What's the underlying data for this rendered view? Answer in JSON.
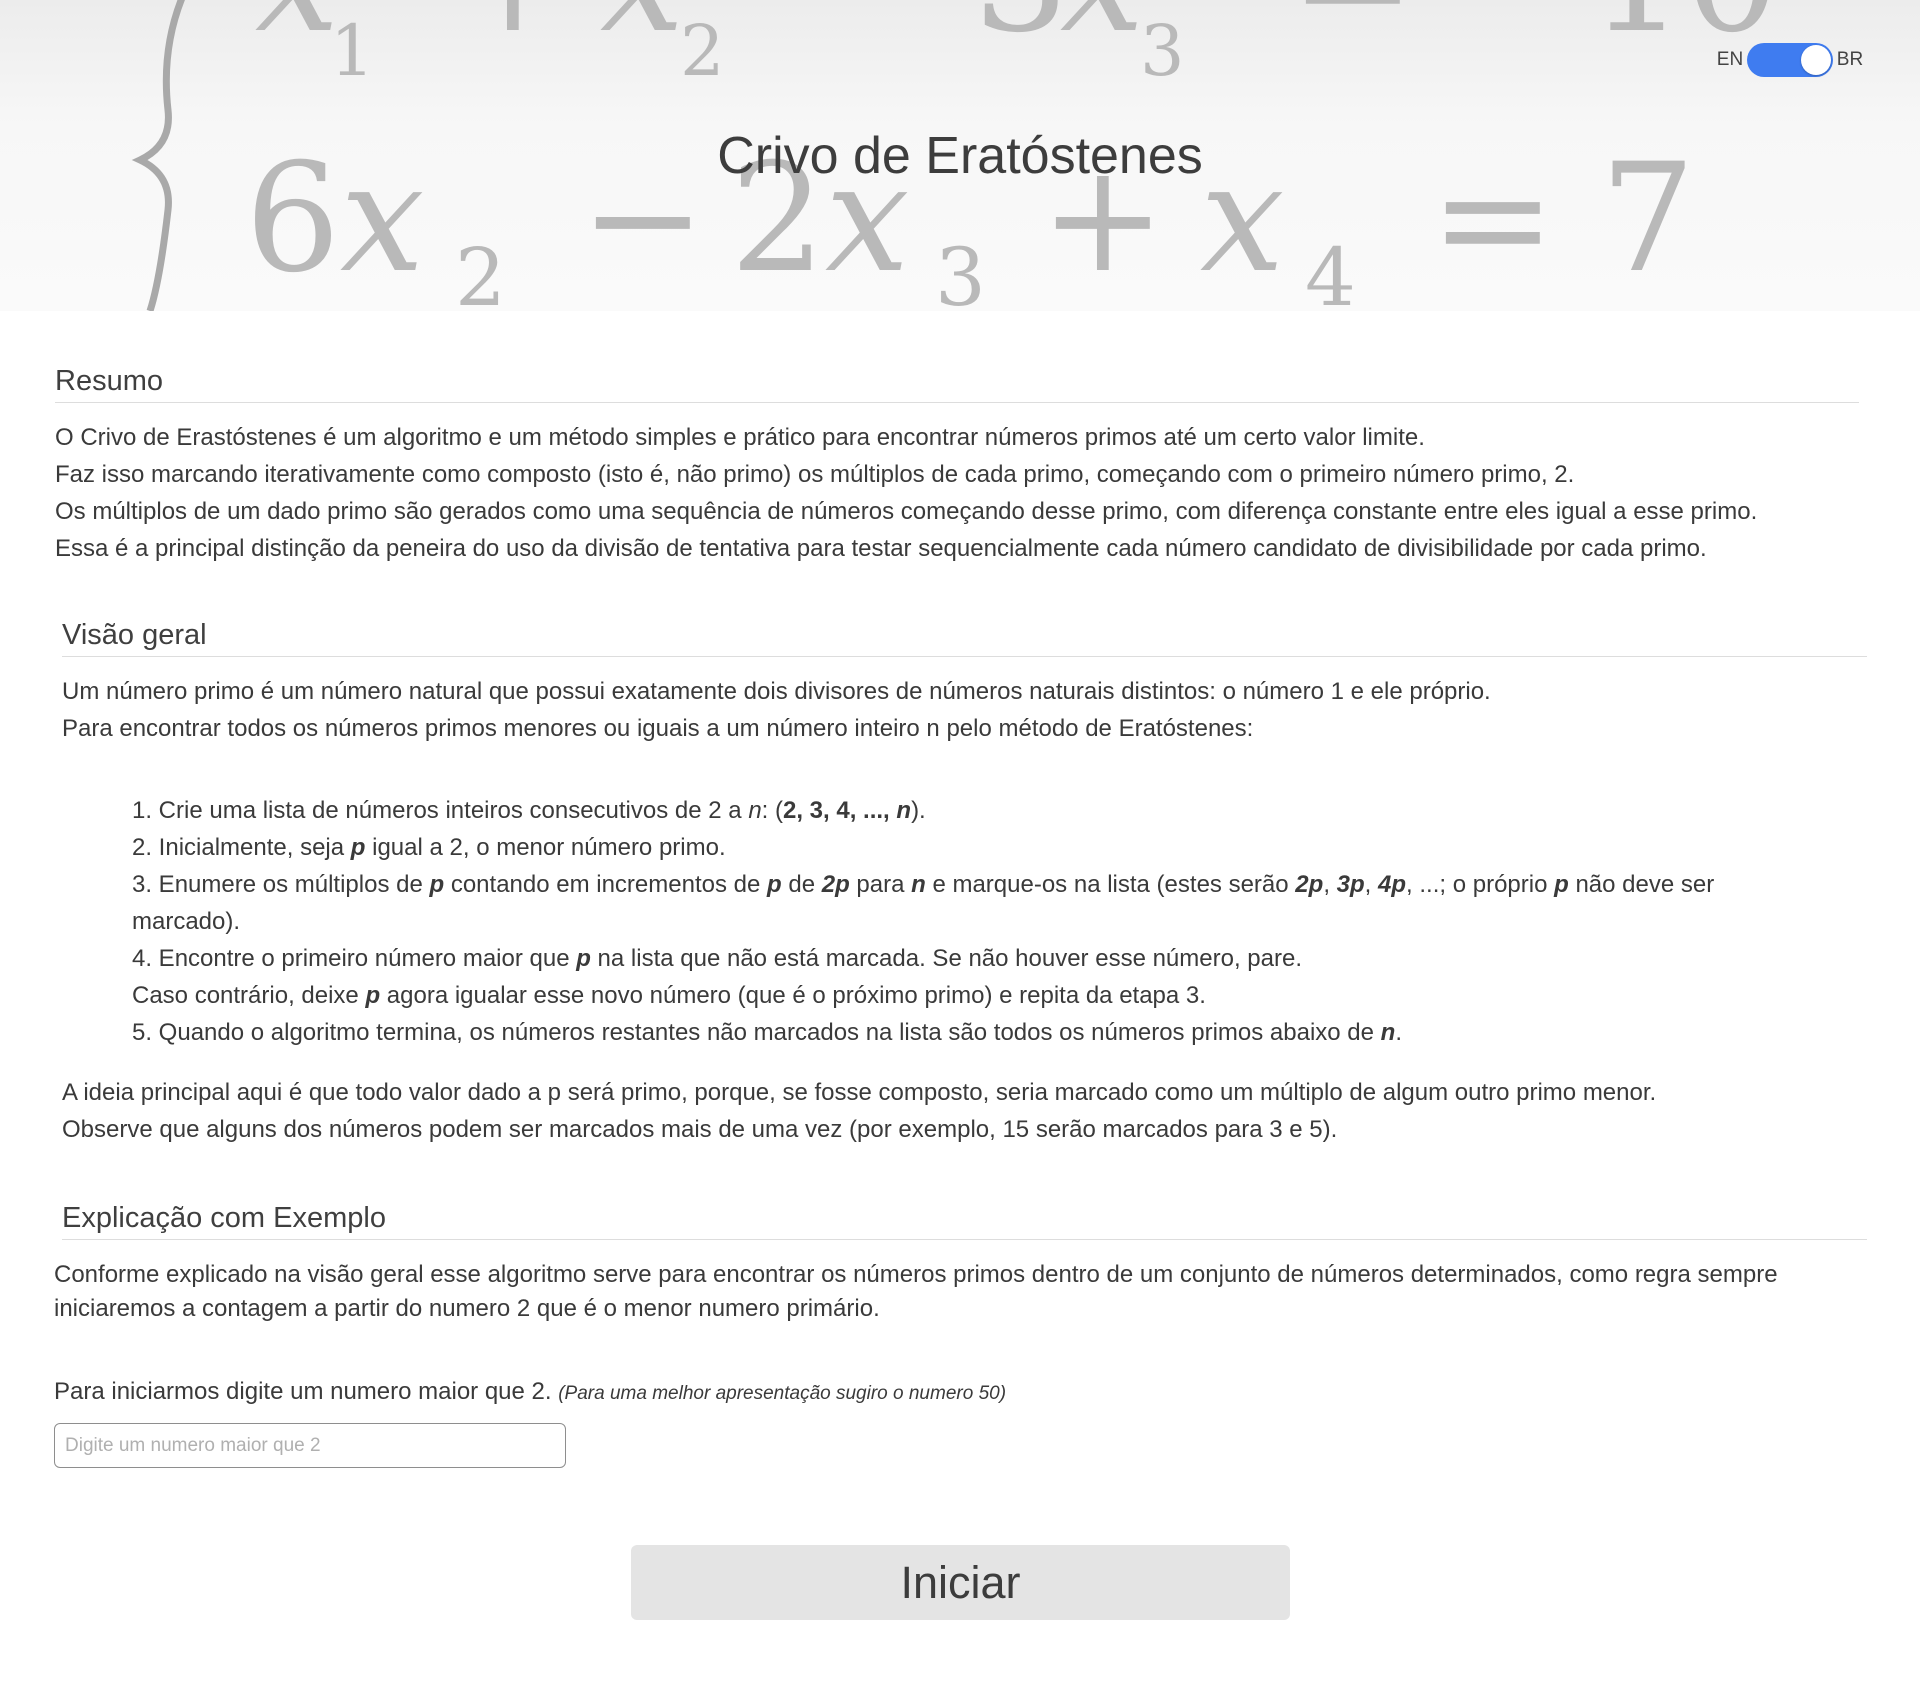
{
  "header": {
    "title": "Crivo de Eratóstenes",
    "lang_en": "EN",
    "lang_br": "BR",
    "toggle_state": "BR"
  },
  "resumo": {
    "heading": "Resumo",
    "lines": [
      "O Crivo de Erastóstenes é um algoritmo e um método simples e prático para encontrar números primos até um certo valor limite.",
      "Faz isso marcando iterativamente como composto (isto é, não primo) os múltiplos de cada primo, começando com o primeiro número primo, 2.",
      "Os múltiplos de um dado primo são gerados como uma sequência de números começando desse primo, com diferença constante entre eles igual a esse primo.",
      "Essa é a principal distinção da peneira do uso da divisão de tentativa para testar sequencialmente cada número candidato de divisibilidade por cada primo."
    ]
  },
  "visao": {
    "heading": "Visão geral",
    "intro": [
      "Um número primo é um número natural que possui exatamente dois divisores de números naturais distintos: o número 1 e ele próprio.",
      "Para encontrar todos os números primos menores ou iguais a um número inteiro n pelo método de Eratóstenes:"
    ],
    "steps": {
      "s1_a": "1. Crie uma lista de números inteiros consecutivos de 2 a ",
      "s1_n": "n",
      "s1_b": ": (",
      "s1_seq": "2, 3, 4, ..., ",
      "s1_n2": "n",
      "s1_c": ").",
      "s2_a": "2. Inicialmente, seja ",
      "s2_p": "p",
      "s2_b": " igual a 2, o menor número primo.",
      "s3_a": "3. Enumere os múltiplos de ",
      "s3_p": "p",
      "s3_b": " contando em incrementos de ",
      "s3_p2": "p",
      "s3_c": " de ",
      "s3_2p": "2p",
      "s3_d": " para ",
      "s3_n": "n",
      "s3_e": " e marque-os na lista (estes serão ",
      "s3_2p_b": "2p",
      "s3_sep1": ", ",
      "s3_3p": "3p",
      "s3_sep2": ", ",
      "s3_4p": "4p",
      "s3_f": ", ...; o próprio ",
      "s3_p3": "p",
      "s3_g": " não deve ser",
      "s3_h": "marcado).",
      "s4_a": "4. Encontre o primeiro número maior que ",
      "s4_p": "p",
      "s4_b": " na lista que não está marcada. Se não houver esse número, pare.",
      "s4_c": "Caso contrário, deixe ",
      "s4_p2": "p",
      "s4_d": " agora igualar esse novo número (que é o próximo primo) e repita da etapa 3.",
      "s5_a": "5. Quando o algoritmo termina, os números restantes não marcados na lista são todos os números primos abaixo de ",
      "s5_n": "n",
      "s5_b": "."
    },
    "outro": [
      "A ideia principal aqui é que todo valor dado a p será primo, porque, se fosse composto, seria marcado como um múltiplo de algum outro primo menor.",
      "Observe que alguns dos números podem ser marcados mais de uma vez (por exemplo, 15 serão marcados para 3 e 5)."
    ]
  },
  "exemplo": {
    "heading": "Explicação com Exemplo",
    "text": "Conforme explicado na visão geral esse algoritmo serve para encontrar os números primos dentro de um conjunto de números determinados, como regra sempre iniciaremos a contagem a partir do numero 2 que é o menor numero primário.",
    "prompt": "Para iniciarmos digite um numero maior que 2.",
    "hint": "(Para uma melhor apresentação sugiro o numero 50)",
    "input_placeholder": "Digite um numero maior que 2",
    "input_value": "",
    "start_label": "Iniciar"
  }
}
